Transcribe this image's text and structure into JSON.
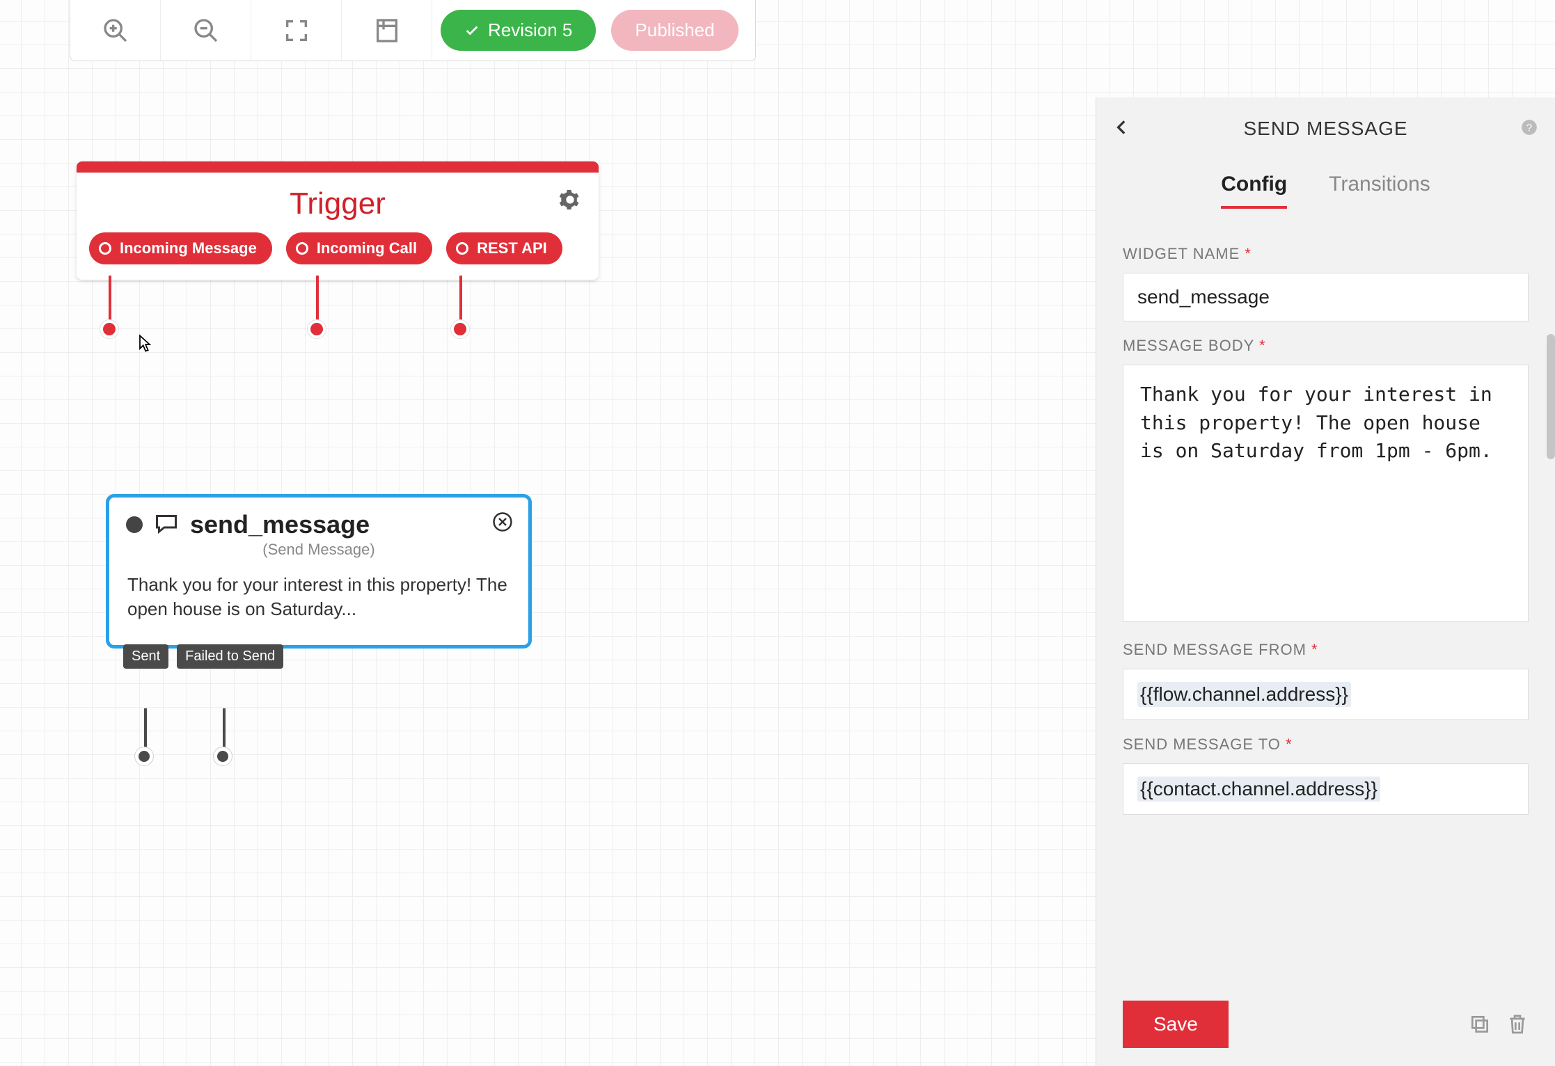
{
  "toolbar": {
    "revision_label": "Revision 5",
    "published_label": "Published"
  },
  "trigger": {
    "title": "Trigger",
    "outputs": [
      "Incoming Message",
      "Incoming Call",
      "REST API"
    ]
  },
  "send_node": {
    "title": "send_message",
    "subtitle": "(Send Message)",
    "body_preview": "Thank you for your interest in this property! The open house is on Saturday...",
    "outputs": [
      "Sent",
      "Failed to Send"
    ]
  },
  "panel": {
    "title": "SEND MESSAGE",
    "tabs": {
      "config": "Config",
      "transitions": "Transitions"
    },
    "labels": {
      "widget_name": "WIDGET NAME",
      "message_body": "MESSAGE BODY",
      "send_from": "SEND MESSAGE FROM",
      "send_to": "SEND MESSAGE TO"
    },
    "values": {
      "widget_name": "send_message",
      "message_body": "Thank you for your interest in this property! The open house is on Saturday from 1pm - 6pm.",
      "send_from": "{{flow.channel.address}}",
      "send_to": "{{contact.channel.address}}"
    },
    "save_label": "Save"
  },
  "colors": {
    "accent_red": "#e12f3a",
    "accent_blue": "#2aa0e6",
    "pill_green": "#3bb54a",
    "pill_pink": "#f2b6be"
  }
}
